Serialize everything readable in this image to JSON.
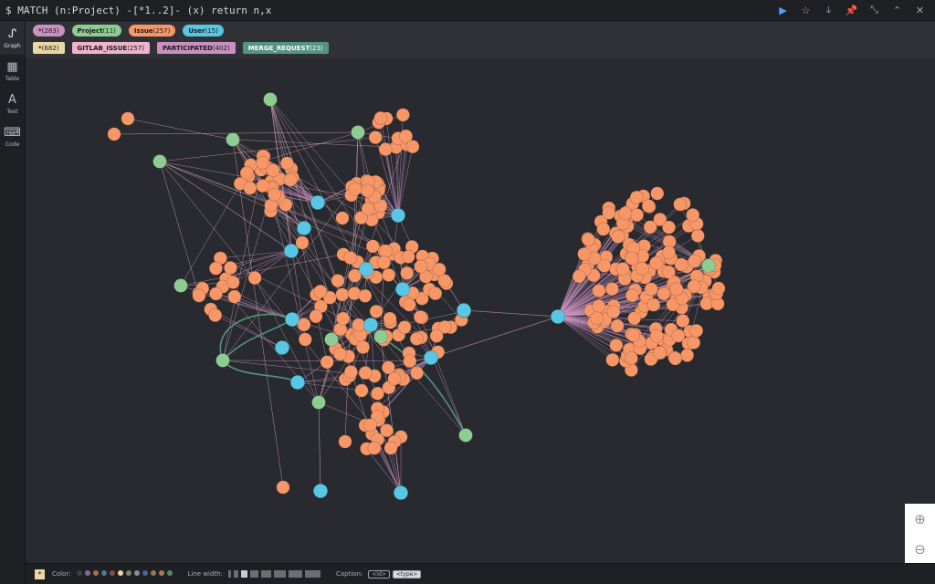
{
  "query": "$ MATCH (n:Project) -[*1..2]- (x) return n,x",
  "top_actions": [
    {
      "name": "run-icon",
      "glyph": "▶"
    },
    {
      "name": "star-icon",
      "glyph": "☆"
    },
    {
      "name": "download-icon",
      "glyph": "⤓"
    },
    {
      "name": "pin-icon",
      "glyph": "📌"
    },
    {
      "name": "collapse-icon",
      "glyph": "⤡"
    },
    {
      "name": "chevron-up-icon",
      "glyph": "⌃"
    },
    {
      "name": "close-icon",
      "glyph": "✕"
    }
  ],
  "sidebar": [
    {
      "label": "Graph",
      "icon": "graph-icon",
      "glyph": "ᔑ"
    },
    {
      "label": "Table",
      "icon": "table-icon",
      "glyph": "▦"
    },
    {
      "label": "Text",
      "icon": "text-icon",
      "glyph": "A"
    },
    {
      "label": "Code",
      "icon": "code-icon",
      "glyph": "⌨"
    }
  ],
  "node_labels": [
    {
      "name": "*",
      "count": "(283)",
      "color": "#c990c0"
    },
    {
      "name": "Project",
      "count": "(11)",
      "color": "#8dcc93"
    },
    {
      "name": "Issue",
      "count": "(257)",
      "color": "#f79767"
    },
    {
      "name": "User",
      "count": "(15)",
      "color": "#57c7e3"
    }
  ],
  "rel_types": [
    {
      "name": "*",
      "count": "(682)",
      "color": "#e9d8a6"
    },
    {
      "name": "GITLAB_ISSUE",
      "count": "(257)",
      "color": "#ecb5c9"
    },
    {
      "name": "PARTICIPATED",
      "count": "(402)",
      "color": "#c990c0"
    },
    {
      "name": "MERGE_REQUEST",
      "count": "(23)",
      "color": "#569480"
    }
  ],
  "colors": {
    "issue": "#f79767",
    "user": "#57c7e3",
    "project": "#8dcc93",
    "gitlab_issue": "#ecb5c9",
    "participated": "#c990c0",
    "merge_request": "#569480"
  },
  "bottom": {
    "expand": "*",
    "color_label": "Color:",
    "line_width_label": "Line width:",
    "caption_label": "Caption:",
    "caption_id": "<id>",
    "caption_type": "<type>",
    "swatches": [
      "#3a3f47",
      "#8b6a8f",
      "#a56c56",
      "#4d7a8a",
      "#8a4a4a",
      "#e9d8a6",
      "#6f8f6f",
      "#8c8c9c",
      "#4f5f9f",
      "#9a7a4a",
      "#b0755f",
      "#5a8a5a"
    ]
  },
  "zoom": {
    "in": "⊕",
    "out": "⊖"
  }
}
